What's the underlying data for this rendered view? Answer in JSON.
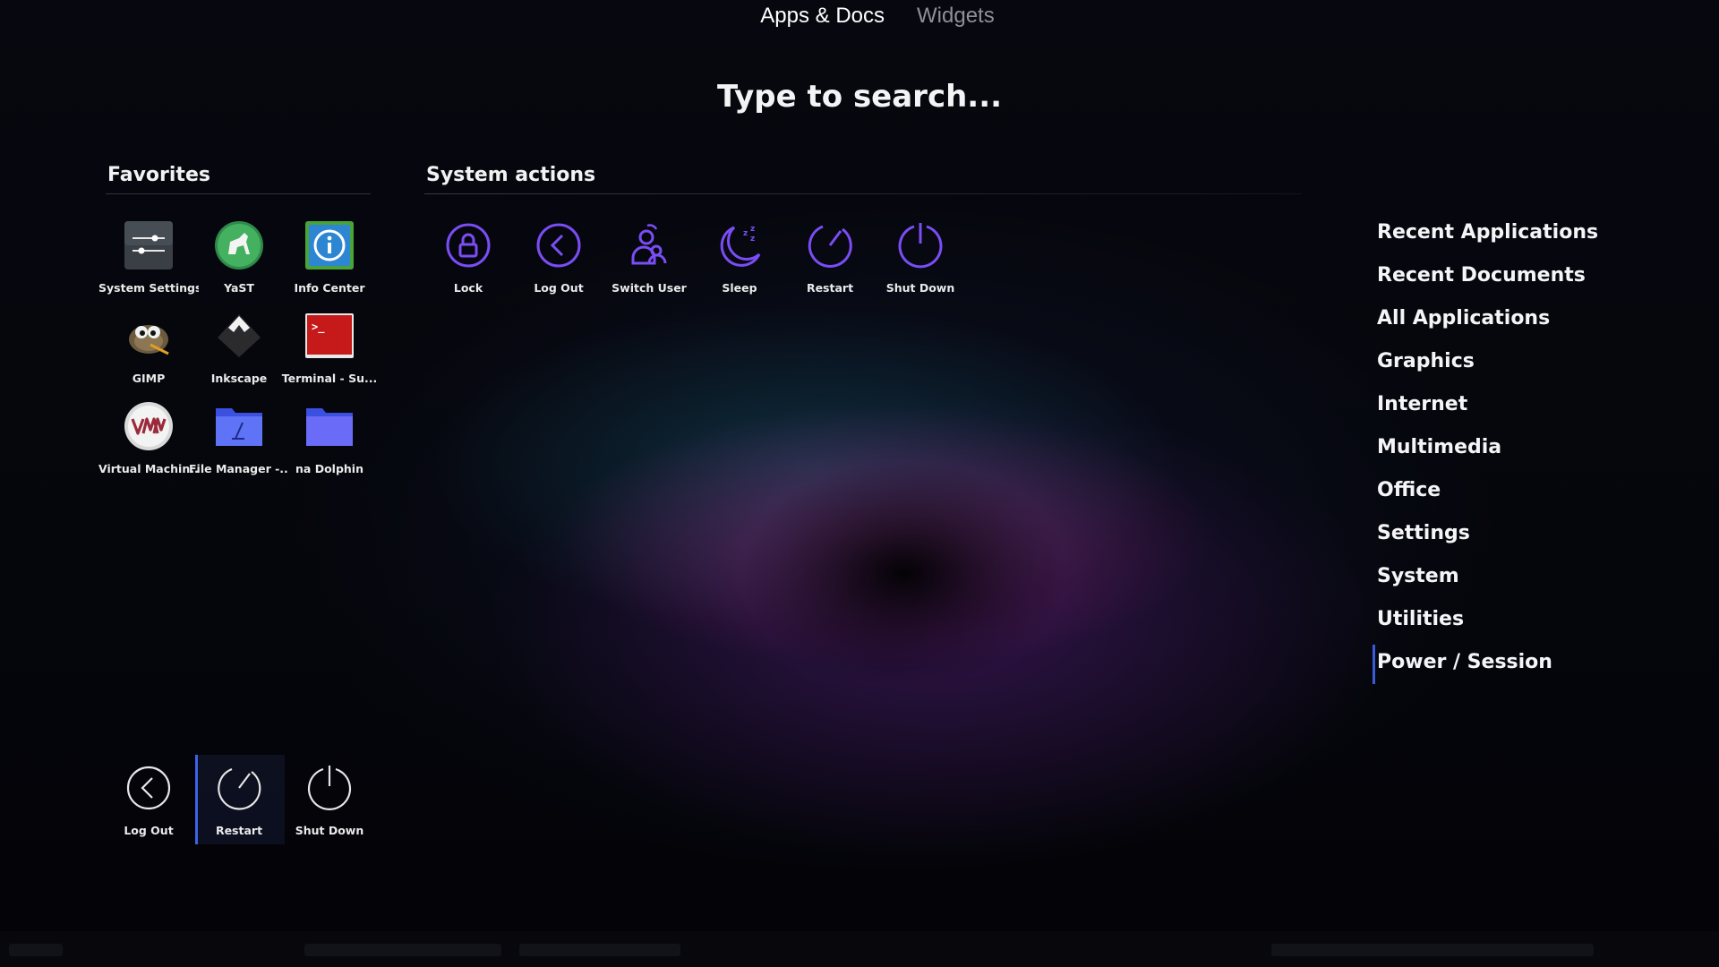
{
  "top_tabs": [
    {
      "label": "Apps & Docs",
      "active": true
    },
    {
      "label": "Widgets",
      "active": false
    }
  ],
  "search": {
    "placeholder": "Type to search..."
  },
  "favorites": {
    "title": "Favorites",
    "items": [
      {
        "label": "System Settings",
        "icon": "system-settings-icon"
      },
      {
        "label": "YaST",
        "icon": "yast-icon"
      },
      {
        "label": "Info Center",
        "icon": "info-center-icon"
      },
      {
        "label": "GIMP",
        "icon": "gimp-icon"
      },
      {
        "label": "Inkscape",
        "icon": "inkscape-icon"
      },
      {
        "label": "Terminal - Su...",
        "icon": "terminal-icon"
      },
      {
        "label": "Virtual Machin...",
        "icon": "virtual-machine-icon"
      },
      {
        "label": "File Manager -...",
        "icon": "file-manager-folder-icon"
      },
      {
        "label": "na Dolphin",
        "icon": "dolphin-folder-icon"
      }
    ]
  },
  "system_actions": {
    "title": "System actions",
    "items": [
      {
        "label": "Lock",
        "icon": "lock-icon"
      },
      {
        "label": "Log Out",
        "icon": "log-out-icon"
      },
      {
        "label": "Switch User",
        "icon": "switch-user-icon"
      },
      {
        "label": "Sleep",
        "icon": "sleep-icon"
      },
      {
        "label": "Restart",
        "icon": "restart-icon"
      },
      {
        "label": "Shut Down",
        "icon": "shut-down-icon"
      }
    ]
  },
  "session_buttons": [
    {
      "label": "Log Out",
      "icon": "log-out-icon"
    },
    {
      "label": "Restart",
      "icon": "restart-icon",
      "active": true
    },
    {
      "label": "Shut Down",
      "icon": "shut-down-icon"
    }
  ],
  "categories": [
    {
      "label": "Recent Applications"
    },
    {
      "label": "Recent Documents"
    },
    {
      "label": "All Applications"
    },
    {
      "label": "Graphics"
    },
    {
      "label": "Internet"
    },
    {
      "label": "Multimedia"
    },
    {
      "label": "Office"
    },
    {
      "label": "Settings"
    },
    {
      "label": "System"
    },
    {
      "label": "Utilities"
    },
    {
      "label": "Power / Session",
      "active": true
    }
  ],
  "colors": {
    "accent": "#3d63e6",
    "action_icon": "#7a4df5",
    "text": "#f2f2f2",
    "inactive_tab": "#8d909a"
  }
}
